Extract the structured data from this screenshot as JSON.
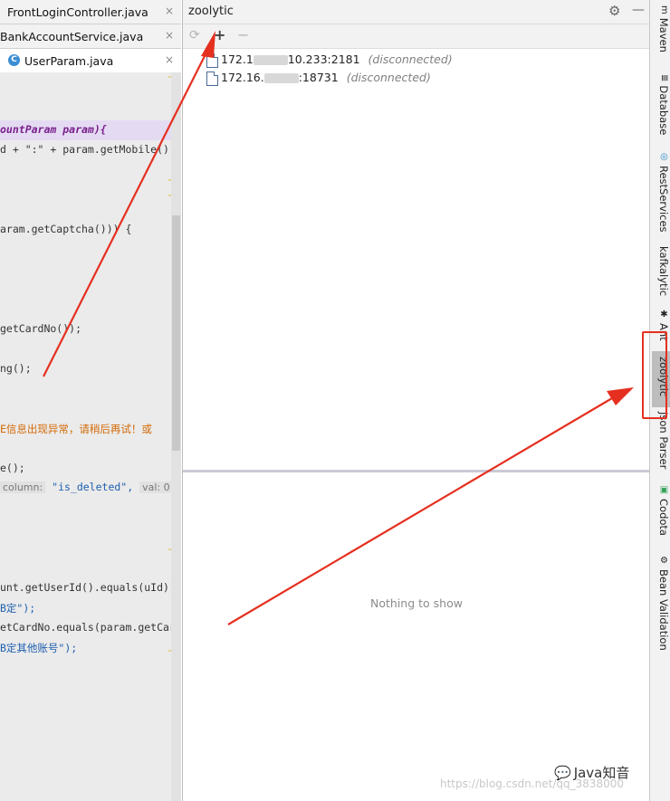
{
  "editor": {
    "tabs": [
      {
        "label": "FrontLoginController.java",
        "close": "×"
      },
      {
        "label": "BankAccountService.java",
        "close": "×"
      },
      {
        "label": "UserParam.java",
        "close": "×",
        "icon": "C"
      }
    ],
    "code_lines": [
      {
        "text": "ountParam param){"
      },
      {
        "text": "d + \":\" + param.getMobile());"
      },
      {
        "text": "aram.getCaptcha())) {"
      },
      {
        "text": "getCardNo());"
      },
      {
        "text": "ng();"
      },
      {
        "text": "E信息出现异常，请稍后再试！或"
      },
      {
        "text": "e();"
      },
      {
        "prefix": "column:",
        "text": "\"is_deleted\",",
        "suffix": "val: 0"
      },
      {
        "text": "unt.getUserId().equals(uId))"
      },
      {
        "text": "B定\");"
      },
      {
        "text": "etCardNo.equals(param.getCard"
      },
      {
        "text": "B定其他账号\");"
      }
    ]
  },
  "tool_window": {
    "title": "zoolytic",
    "toolbar": {
      "refresh": "⟳",
      "add": "+",
      "remove": "−"
    },
    "connections": [
      {
        "addr_start": "172.1",
        "addr_end": "10.233:2181",
        "status": "(disconnected)"
      },
      {
        "addr_start": "172.16.",
        "addr_end": ":18731",
        "status": "(disconnected)"
      }
    ],
    "empty_text": "Nothing to show"
  },
  "right_strip": {
    "items": [
      {
        "label": "Maven",
        "icon": "m"
      },
      {
        "label": "Database",
        "icon": "≣"
      },
      {
        "label": "RestServices",
        "icon": "◎"
      },
      {
        "label": "kafkalytic",
        "icon": ""
      },
      {
        "label": "Ant",
        "icon": "✱"
      },
      {
        "label": "zoolytic",
        "icon": "",
        "selected": true
      },
      {
        "label": "Json Parser",
        "icon": ""
      },
      {
        "label": "Codota",
        "icon": "▣"
      },
      {
        "label": "Bean Validation",
        "icon": "⚙"
      }
    ]
  },
  "watermark": {
    "text": "https://blog.csdn.net/qq_3838000"
  },
  "brand": {
    "text": "Java知音",
    "icon": "💬"
  },
  "colors": {
    "arrow": "#e53020",
    "accent": "#3b8dd3"
  }
}
